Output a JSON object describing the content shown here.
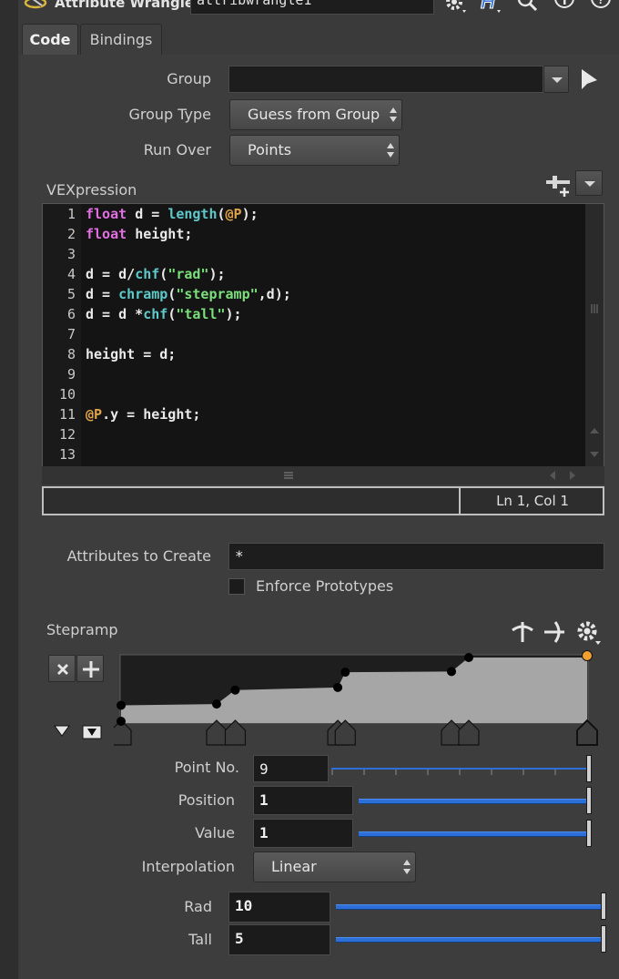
{
  "header": {
    "node_type": "Attribute Wrangle",
    "node_name": "attribwrangle1"
  },
  "tabs": [
    {
      "label": "Code",
      "active": true
    },
    {
      "label": "Bindings",
      "active": false
    }
  ],
  "params": {
    "group_label": "Group",
    "group_value": "",
    "group_type_label": "Group Type",
    "group_type_value": "Guess from Group",
    "run_over_label": "Run Over",
    "run_over_value": "Points",
    "vexpression_label": "VEXpression",
    "attributes_label": "Attributes to Create",
    "attributes_value": "*",
    "enforce_label": "Enforce Prototypes",
    "enforce_checked": false
  },
  "code": {
    "line_numbers": [
      "1",
      "2",
      "3",
      "4",
      "5",
      "6",
      "7",
      "8",
      "9",
      "10",
      "11",
      "12",
      "13"
    ],
    "status_left": "",
    "status_right": "Ln 1, Col 1"
  },
  "ramp": {
    "label": "Stepramp",
    "point_no_label": "Point No.",
    "point_no_value": "9",
    "position_label": "Position",
    "position_value": "1",
    "value_label": "Value",
    "value_value": "1",
    "interpolation_label": "Interpolation",
    "interpolation_value": "Linear",
    "curve_points": [
      {
        "pos": 0.0,
        "val": 0.0
      },
      {
        "pos": 0.0,
        "val": 0.25
      },
      {
        "pos": 0.205,
        "val": 0.27
      },
      {
        "pos": 0.245,
        "val": 0.49
      },
      {
        "pos": 0.465,
        "val": 0.53
      },
      {
        "pos": 0.481,
        "val": 0.77
      },
      {
        "pos": 0.709,
        "val": 0.78
      },
      {
        "pos": 0.746,
        "val": 1.0
      },
      {
        "pos": 1.0,
        "val": 1.0
      }
    ],
    "selected_point_level": 1.0
  },
  "sliders": {
    "rad_label": "Rad",
    "rad_value": "10",
    "rad_level": 1.0,
    "tall_label": "Tall",
    "tall_value": "5",
    "tall_level": 1.0
  },
  "colors": {
    "keyword": "#e26ee2",
    "function": "#5fc9c9",
    "string": "#7be07b",
    "attribute": "#e0a34a",
    "slider": "#2c6fd6",
    "selected_point": "#f0a030"
  }
}
